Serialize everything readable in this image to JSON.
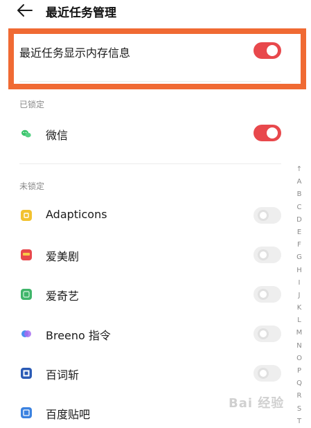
{
  "header": {
    "title": "最近任务管理"
  },
  "memory_setting": {
    "label": "最近任务显示内存信息",
    "enabled": true
  },
  "locked": {
    "title": "已锁定",
    "apps": [
      {
        "name": "微信",
        "locked": true,
        "icon": "wechat-icon",
        "color": "#39c46a"
      }
    ]
  },
  "unlocked": {
    "title": "未锁定",
    "apps": [
      {
        "name": "Adapticons",
        "locked": false,
        "icon": "adapticons-icon",
        "color": "#f2c230"
      },
      {
        "name": "爱美剧",
        "locked": false,
        "icon": "aimeiju-icon",
        "color": "#e8484c"
      },
      {
        "name": "爱奇艺",
        "locked": false,
        "icon": "iqiyi-icon",
        "color": "#3fb56a"
      },
      {
        "name": "Breeno 指令",
        "locked": false,
        "icon": "breeno-icon",
        "color": "#7b5cf0"
      },
      {
        "name": "百词斩",
        "locked": false,
        "icon": "baicizhan-icon",
        "color": "#2a5ab5"
      },
      {
        "name": "百度贴吧",
        "locked": false,
        "icon": "tieba-icon",
        "color": "#3b82e0"
      }
    ]
  },
  "index_letters": [
    "↑",
    "A",
    "B",
    "C",
    "D",
    "E",
    "F",
    "G",
    "H",
    "I",
    "J",
    "K",
    "L",
    "M",
    "N",
    "O",
    "P",
    "Q",
    "R",
    "S",
    "T"
  ],
  "watermark": "Bai 经验"
}
